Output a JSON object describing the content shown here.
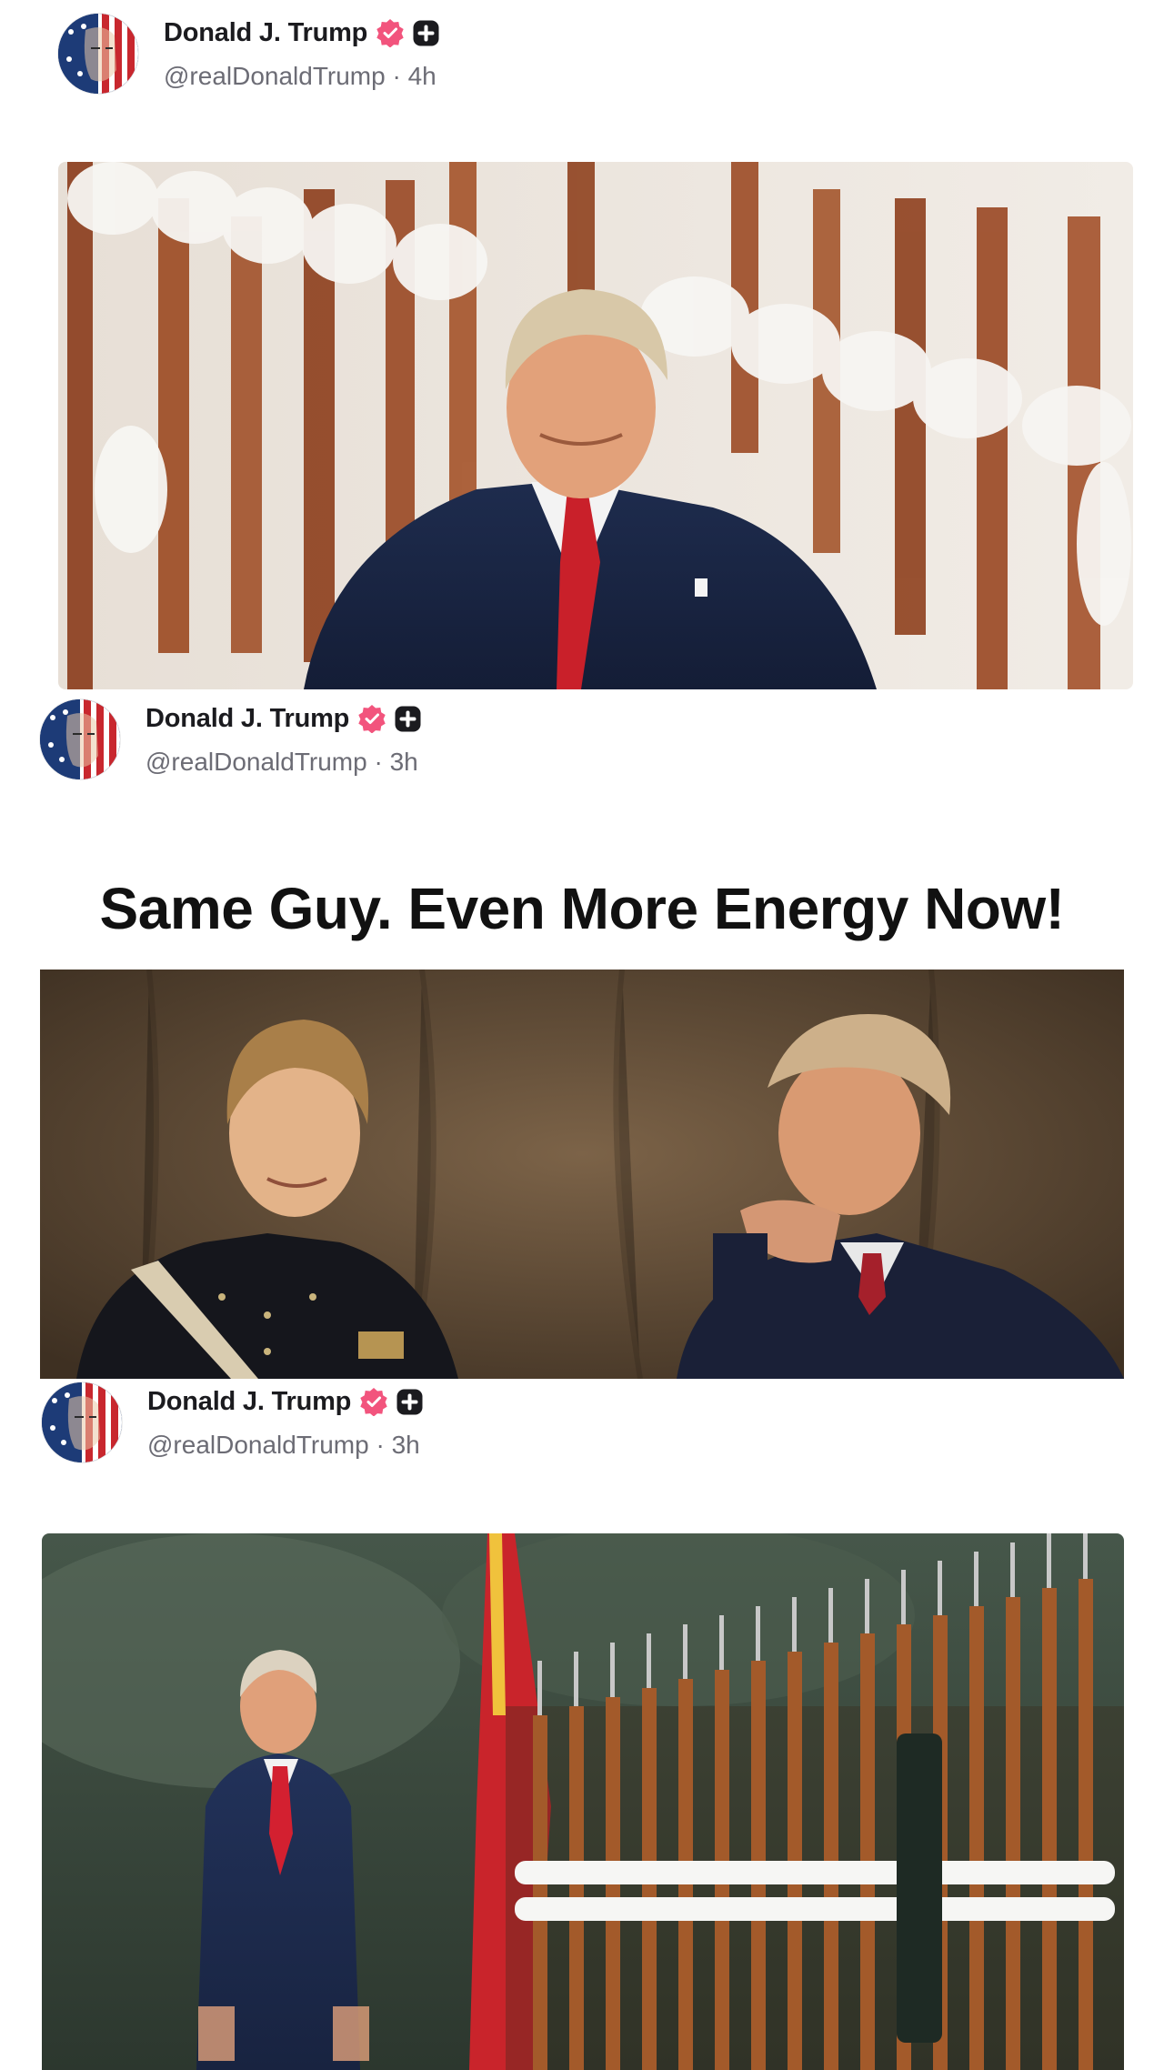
{
  "posts": [
    {
      "author": {
        "name": "Donald J. Trump",
        "handle": "@realDonaldTrump"
      },
      "time": "4h"
    },
    {
      "author": {
        "name": "Donald J. Trump",
        "handle": "@realDonaldTrump"
      },
      "time": "3h",
      "caption": "Same Guy. Even More Energy Now!"
    },
    {
      "author": {
        "name": "Donald J. Trump",
        "handle": "@realDonaldTrump"
      },
      "time": "3h"
    }
  ],
  "separator": "·",
  "icons": {
    "verified": "verified-badge-icon",
    "plus": "plus-badge-icon"
  },
  "colors": {
    "verified_badge": "#f2547d",
    "plus_badge": "#1b1b1f",
    "name_text": "#1b1b1f",
    "handle_text": "#6c6c75"
  }
}
